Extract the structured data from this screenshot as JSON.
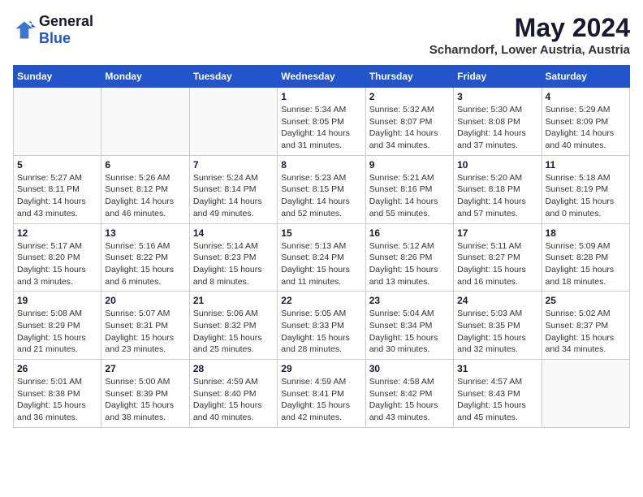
{
  "header": {
    "logo_general": "General",
    "logo_blue": "Blue",
    "month_year": "May 2024",
    "location": "Scharndorf, Lower Austria, Austria"
  },
  "weekdays": [
    "Sunday",
    "Monday",
    "Tuesday",
    "Wednesday",
    "Thursday",
    "Friday",
    "Saturday"
  ],
  "weeks": [
    [
      {
        "day": "",
        "info": ""
      },
      {
        "day": "",
        "info": ""
      },
      {
        "day": "",
        "info": ""
      },
      {
        "day": "1",
        "info": "Sunrise: 5:34 AM\nSunset: 8:05 PM\nDaylight: 14 hours\nand 31 minutes."
      },
      {
        "day": "2",
        "info": "Sunrise: 5:32 AM\nSunset: 8:07 PM\nDaylight: 14 hours\nand 34 minutes."
      },
      {
        "day": "3",
        "info": "Sunrise: 5:30 AM\nSunset: 8:08 PM\nDaylight: 14 hours\nand 37 minutes."
      },
      {
        "day": "4",
        "info": "Sunrise: 5:29 AM\nSunset: 8:09 PM\nDaylight: 14 hours\nand 40 minutes."
      }
    ],
    [
      {
        "day": "5",
        "info": "Sunrise: 5:27 AM\nSunset: 8:11 PM\nDaylight: 14 hours\nand 43 minutes."
      },
      {
        "day": "6",
        "info": "Sunrise: 5:26 AM\nSunset: 8:12 PM\nDaylight: 14 hours\nand 46 minutes."
      },
      {
        "day": "7",
        "info": "Sunrise: 5:24 AM\nSunset: 8:14 PM\nDaylight: 14 hours\nand 49 minutes."
      },
      {
        "day": "8",
        "info": "Sunrise: 5:23 AM\nSunset: 8:15 PM\nDaylight: 14 hours\nand 52 minutes."
      },
      {
        "day": "9",
        "info": "Sunrise: 5:21 AM\nSunset: 8:16 PM\nDaylight: 14 hours\nand 55 minutes."
      },
      {
        "day": "10",
        "info": "Sunrise: 5:20 AM\nSunset: 8:18 PM\nDaylight: 14 hours\nand 57 minutes."
      },
      {
        "day": "11",
        "info": "Sunrise: 5:18 AM\nSunset: 8:19 PM\nDaylight: 15 hours\nand 0 minutes."
      }
    ],
    [
      {
        "day": "12",
        "info": "Sunrise: 5:17 AM\nSunset: 8:20 PM\nDaylight: 15 hours\nand 3 minutes."
      },
      {
        "day": "13",
        "info": "Sunrise: 5:16 AM\nSunset: 8:22 PM\nDaylight: 15 hours\nand 6 minutes."
      },
      {
        "day": "14",
        "info": "Sunrise: 5:14 AM\nSunset: 8:23 PM\nDaylight: 15 hours\nand 8 minutes."
      },
      {
        "day": "15",
        "info": "Sunrise: 5:13 AM\nSunset: 8:24 PM\nDaylight: 15 hours\nand 11 minutes."
      },
      {
        "day": "16",
        "info": "Sunrise: 5:12 AM\nSunset: 8:26 PM\nDaylight: 15 hours\nand 13 minutes."
      },
      {
        "day": "17",
        "info": "Sunrise: 5:11 AM\nSunset: 8:27 PM\nDaylight: 15 hours\nand 16 minutes."
      },
      {
        "day": "18",
        "info": "Sunrise: 5:09 AM\nSunset: 8:28 PM\nDaylight: 15 hours\nand 18 minutes."
      }
    ],
    [
      {
        "day": "19",
        "info": "Sunrise: 5:08 AM\nSunset: 8:29 PM\nDaylight: 15 hours\nand 21 minutes."
      },
      {
        "day": "20",
        "info": "Sunrise: 5:07 AM\nSunset: 8:31 PM\nDaylight: 15 hours\nand 23 minutes."
      },
      {
        "day": "21",
        "info": "Sunrise: 5:06 AM\nSunset: 8:32 PM\nDaylight: 15 hours\nand 25 minutes."
      },
      {
        "day": "22",
        "info": "Sunrise: 5:05 AM\nSunset: 8:33 PM\nDaylight: 15 hours\nand 28 minutes."
      },
      {
        "day": "23",
        "info": "Sunrise: 5:04 AM\nSunset: 8:34 PM\nDaylight: 15 hours\nand 30 minutes."
      },
      {
        "day": "24",
        "info": "Sunrise: 5:03 AM\nSunset: 8:35 PM\nDaylight: 15 hours\nand 32 minutes."
      },
      {
        "day": "25",
        "info": "Sunrise: 5:02 AM\nSunset: 8:37 PM\nDaylight: 15 hours\nand 34 minutes."
      }
    ],
    [
      {
        "day": "26",
        "info": "Sunrise: 5:01 AM\nSunset: 8:38 PM\nDaylight: 15 hours\nand 36 minutes."
      },
      {
        "day": "27",
        "info": "Sunrise: 5:00 AM\nSunset: 8:39 PM\nDaylight: 15 hours\nand 38 minutes."
      },
      {
        "day": "28",
        "info": "Sunrise: 4:59 AM\nSunset: 8:40 PM\nDaylight: 15 hours\nand 40 minutes."
      },
      {
        "day": "29",
        "info": "Sunrise: 4:59 AM\nSunset: 8:41 PM\nDaylight: 15 hours\nand 42 minutes."
      },
      {
        "day": "30",
        "info": "Sunrise: 4:58 AM\nSunset: 8:42 PM\nDaylight: 15 hours\nand 43 minutes."
      },
      {
        "day": "31",
        "info": "Sunrise: 4:57 AM\nSunset: 8:43 PM\nDaylight: 15 hours\nand 45 minutes."
      },
      {
        "day": "",
        "info": ""
      }
    ]
  ]
}
